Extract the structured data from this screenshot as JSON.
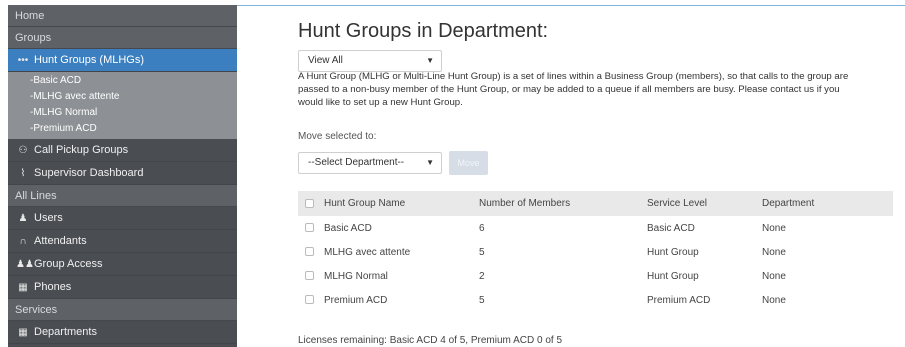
{
  "sidebar": {
    "home": "Home",
    "groups_section": "Groups",
    "hunt_groups": "Hunt Groups (MLHGs)",
    "sub_items": [
      "-Basic ACD",
      "-MLHG avec attente",
      "-MLHG Normal",
      "-Premium ACD"
    ],
    "call_pickup": "Call Pickup Groups",
    "supervisor": "Supervisor Dashboard",
    "all_lines_section": "All Lines",
    "users": "Users",
    "attendants": "Attendants",
    "group_access": "Group Access",
    "phones": "Phones",
    "services_section": "Services",
    "departments": "Departments"
  },
  "main": {
    "title": "Hunt Groups in Department:",
    "filter_value": "View All",
    "description": "A Hunt Group (MLHG or Multi-Line Hunt Group) is a set of lines within a Business Group (members), so that calls to the group are passed to a non-busy member of the Hunt Group, or may be added to a queue if all members are busy. Please contact us if you would like to set up a new Hunt Group.",
    "move_label": "Move selected to:",
    "department_select": "--Select Department--",
    "move_button": "Move",
    "table": {
      "headers": [
        "Hunt Group Name",
        "Number of Members",
        "Service Level",
        "Department"
      ],
      "rows": [
        [
          "Basic ACD",
          "6",
          "Basic ACD",
          "None"
        ],
        [
          "MLHG avec attente",
          "5",
          "Hunt Group",
          "None"
        ],
        [
          "MLHG Normal",
          "2",
          "Hunt Group",
          "None"
        ],
        [
          "Premium ACD",
          "5",
          "Premium ACD",
          "None"
        ]
      ]
    },
    "licenses": "Licenses remaining: Basic ACD 4 of 5, Premium ACD 0 of 5"
  },
  "colors": {
    "sidebar_bg": "#4a4d52",
    "active_bg": "#3b7fc0",
    "submenu_bg": "#8d9095",
    "header_row_bg": "#e9e9e9"
  }
}
